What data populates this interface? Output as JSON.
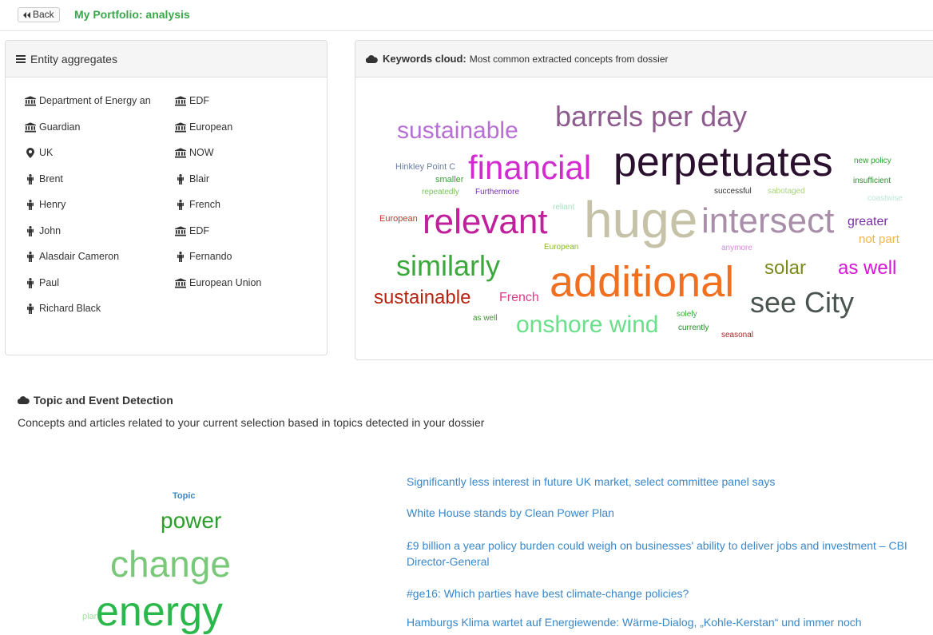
{
  "header": {
    "back_label": "Back",
    "title": "My Portfolio: analysis"
  },
  "entity_panel": {
    "title": "Entity aggregates",
    "col1": [
      {
        "icon": "institution-icon",
        "label": "Department of Energy an"
      },
      {
        "icon": "institution-icon",
        "label": "Guardian"
      },
      {
        "icon": "map-marker-icon",
        "label": "UK"
      },
      {
        "icon": "person-icon",
        "label": "Brent"
      },
      {
        "icon": "person-icon",
        "label": "Henry"
      },
      {
        "icon": "person-icon",
        "label": "John"
      },
      {
        "icon": "person-icon",
        "label": "Alasdair Cameron"
      },
      {
        "icon": "person-icon",
        "label": "Paul"
      },
      {
        "icon": "person-icon",
        "label": "Richard Black"
      }
    ],
    "col2": [
      {
        "icon": "institution-icon",
        "label": "EDF"
      },
      {
        "icon": "institution-icon",
        "label": "European"
      },
      {
        "icon": "institution-icon",
        "label": "NOW"
      },
      {
        "icon": "person-icon",
        "label": "Blair"
      },
      {
        "icon": "person-icon",
        "label": "French"
      },
      {
        "icon": "institution-icon",
        "label": "EDF"
      },
      {
        "icon": "person-icon",
        "label": "Fernando"
      },
      {
        "icon": "institution-icon",
        "label": "European Union"
      }
    ]
  },
  "keywords_panel": {
    "title": "Keywords cloud:",
    "subtitle": "Most common extracted concepts from dossier",
    "words": [
      {
        "text": "barrels per day",
        "color": "#8e5c8e"
      },
      {
        "text": "sustainable",
        "color": "#b76fd4"
      },
      {
        "text": "Hinkley Point C",
        "color": "#6b7fa3"
      },
      {
        "text": "smaller",
        "color": "#3aa13a"
      },
      {
        "text": "repeatedly",
        "color": "#79c45a"
      },
      {
        "text": "Furthermore",
        "color": "#7a2fb5"
      },
      {
        "text": "financial",
        "color": "#d12bd0"
      },
      {
        "text": "perpetuates",
        "color": "#2a0f2e"
      },
      {
        "text": "new policy",
        "color": "#2ea42e"
      },
      {
        "text": "insufficient",
        "color": "#2e8c2e"
      },
      {
        "text": "successful",
        "color": "#333333"
      },
      {
        "text": "sabotaged",
        "color": "#a8d47a"
      },
      {
        "text": "coastwise",
        "color": "#bfe6da"
      },
      {
        "text": "European",
        "color": "#c0392b"
      },
      {
        "text": "relevant",
        "color": "#c0209c"
      },
      {
        "text": "reliant",
        "color": "#a8e0c0"
      },
      {
        "text": "huge",
        "color": "#c5c2a8"
      },
      {
        "text": "intersect",
        "color": "#a88ea8"
      },
      {
        "text": "greater",
        "color": "#7b2ca8"
      },
      {
        "text": "not part",
        "color": "#f0b54a"
      },
      {
        "text": "European",
        "color": "#8ab82a"
      },
      {
        "text": "anymore",
        "color": "#d88ad8"
      },
      {
        "text": "similarly",
        "color": "#3aa83a"
      },
      {
        "text": "solar",
        "color": "#7a8a1a"
      },
      {
        "text": "as well",
        "color": "#d418d4"
      },
      {
        "text": "sustainable",
        "color": "#b5230f"
      },
      {
        "text": "French",
        "color": "#e03a8a"
      },
      {
        "text": "additional",
        "color": "#f07020"
      },
      {
        "text": "see City",
        "color": "#4a5550"
      },
      {
        "text": "as well",
        "color": "#3a9a2a"
      },
      {
        "text": "onshore wind",
        "color": "#6ae08a"
      },
      {
        "text": "solely",
        "color": "#3aa83a"
      },
      {
        "text": "currently",
        "color": "#2a8a2a"
      },
      {
        "text": "seasonal",
        "color": "#a02a2a"
      }
    ]
  },
  "topics": {
    "title": "Topic and Event Detection",
    "description": "Concepts and articles related to your current selection based in topics detected in your dossier",
    "cloud": [
      {
        "text": "Topic",
        "color": "#3a87c9"
      },
      {
        "text": "power",
        "color": "#2aa02a"
      },
      {
        "text": "change",
        "color": "#7ac87a"
      },
      {
        "text": "plan",
        "color": "#a8e0a8"
      },
      {
        "text": "energy",
        "color": "#2ab84a"
      }
    ],
    "articles": [
      "Significantly less interest in future UK market, select committee panel says",
      "White House stands by Clean Power Plan",
      "£9 billion a year policy burden could weigh on businesses' ability to deliver jobs and investment – CBI Director-General",
      "#ge16: Which parties have best climate-change policies?",
      "Hamburgs Klima wartet auf Energiewende: Wärme-Dialog, „Kohle-Kerstan“ und immer noch"
    ]
  }
}
